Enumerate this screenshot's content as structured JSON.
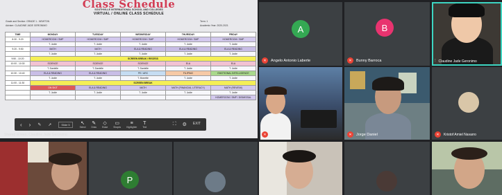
{
  "schedule": {
    "title": "Class Schedule",
    "school": "SOUTHVILLE INTERNATIONAL SCHOOL AND COLLEGES",
    "subtitle": "VIRTUAL / ONLINE CLASS SCHEDULE",
    "meta_left1": "Grade and Section: GRADE 1 - NEWTON",
    "meta_left2": "Adviser: CLAUDINE JADE GERONIMO",
    "meta_right1": "Term: 1",
    "meta_right2": "Academic Year: 2020-2021",
    "columns": [
      "TIME",
      "MONDAY",
      "TUESDAY",
      "WEDNESDAY",
      "THURSDAY",
      "FRIDAY"
    ],
    "rows": [
      {
        "time": "8:30 - 9:20",
        "cells": [
          "HOMEROOM / SMP",
          "HOMEROOM / SMP",
          "HOMEROOM / SMP",
          "HOMEROOM / SMP",
          "HOMEROOM / SMP"
        ],
        "colors": [
          "lav",
          "lav",
          "lav",
          "lav",
          "lav"
        ]
      },
      {
        "time": "",
        "cells": [
          "T. Jodie",
          "T. Jodie",
          "T. Jodie",
          "T. Jodie",
          "T. Jodie"
        ],
        "colors": [
          "white",
          "white",
          "white",
          "white",
          "white"
        ]
      },
      {
        "time": "9:20 - 9:50",
        "cells": [
          "MATH",
          "MATH",
          "ELA & READING",
          "ELA & READING",
          "ELA & READING"
        ],
        "colors": [
          "lav",
          "lav",
          "lav2",
          "lav2",
          "lav2"
        ]
      },
      {
        "time": "",
        "cells": [
          "T. Jodie",
          "T. Jodie",
          "T. Jodie",
          "T. Jodie",
          "T. Jodie"
        ],
        "colors": [
          "white",
          "white",
          "white",
          "white",
          "white"
        ]
      },
      {
        "time": "9:50 - 10:20",
        "cells": [
          "SCREEN BREAK / RECESS"
        ],
        "colors": [
          "yel"
        ]
      },
      {
        "time": "10:00 - 10:30",
        "cells": [
          "SCIENCE",
          "SCIENCE",
          "SCIENCE",
          "ELA",
          "ELA"
        ],
        "colors": [
          "pink",
          "pink",
          "pink",
          "pink",
          "pink"
        ]
      },
      {
        "time": "",
        "cells": [
          "T. Danielle",
          "T. Danielle",
          "T. Danielle",
          "T. Jodie",
          "T. Jodie"
        ],
        "colors": [
          "white",
          "white",
          "white",
          "white",
          "white"
        ]
      },
      {
        "time": "10:30 - 10:40",
        "cells": [
          "ELA & READING",
          "ELA & READING",
          "PE / ARC",
          "FILIPINO",
          "EMOTIONAL INTELLIGENCE"
        ],
        "colors": [
          "lav2",
          "lav2",
          "blue",
          "peach",
          "green"
        ]
      },
      {
        "time": "",
        "cells": [
          "T. Jodie",
          "T. Jodie",
          "T. Monette",
          "T. Jodie",
          "T. Jodie"
        ],
        "colors": [
          "white",
          "white",
          "white",
          "white",
          "white"
        ]
      },
      {
        "time": "11:00 - 11:30",
        "cells": [
          "SCREEN BREAK"
        ],
        "colors": [
          "yel"
        ]
      },
      {
        "time": "",
        "cells": [
          "ON SKIT",
          "ELA & READING",
          "MATH",
          "MATH (FINANCIAL LITERACY)",
          "MATH (REVIEW)"
        ],
        "colors": [
          "red",
          "lav2",
          "lav",
          "lav",
          "lav"
        ]
      },
      {
        "time": "",
        "cells": [
          "T. Jodie",
          "T. Jodie",
          "T. Jodie",
          "T. Jodie",
          "T. Jodie"
        ],
        "colors": [
          "white",
          "white",
          "white",
          "white",
          "white"
        ]
      },
      {
        "time": "",
        "cells": [
          "",
          "",
          "",
          "",
          "HOMEROOM / SMP / DISMISSAL"
        ],
        "colors": [
          "white",
          "white",
          "white",
          "white",
          "lav"
        ]
      }
    ]
  },
  "share_toolbar": {
    "zoom": "Slide 5",
    "buttons": [
      {
        "icon": "↖",
        "label": "Select"
      },
      {
        "icon": "✎",
        "label": "Draw"
      },
      {
        "icon": "◇",
        "label": "Erase"
      },
      {
        "icon": "▭",
        "label": "Shapes"
      },
      {
        "icon": "≡",
        "label": "Highlighter"
      },
      {
        "icon": "T",
        "label": "Text"
      }
    ],
    "right_buttons": [
      "⛶",
      "⚙",
      "EXIT"
    ]
  },
  "share_caption": "Shared screen: Claudine Jade Geronimo",
  "participants": [
    {
      "key": "a",
      "initial": "A",
      "name": "Angelo Antonio Laberte",
      "avatar_color": "#34a853"
    },
    {
      "key": "b",
      "initial": "B",
      "name": "Bunny Barroca",
      "avatar_color": "#e8336f"
    },
    {
      "key": "c",
      "name": "Claudine Jade Geronimo"
    },
    {
      "key": "d",
      "name": ""
    },
    {
      "key": "e",
      "name": "Jorge Daniel"
    },
    {
      "key": "f",
      "name": "Kristof Amiel Navarro"
    },
    {
      "key": "g",
      "name": ""
    },
    {
      "key": "h",
      "initial": "P",
      "name": "",
      "avatar_color": "#2e7d32"
    },
    {
      "key": "i",
      "name": ""
    },
    {
      "key": "j",
      "name": ""
    },
    {
      "key": "k",
      "name": ""
    }
  ],
  "colors": {
    "muted_badge": "#ea4335",
    "active_speaker": "#3dd6c2",
    "tile_bg": "#3c4043"
  }
}
